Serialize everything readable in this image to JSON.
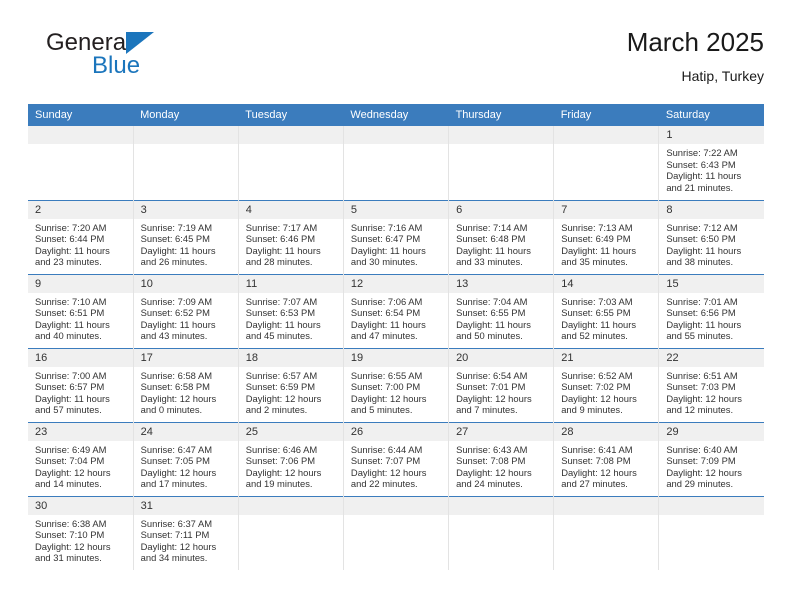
{
  "brand": {
    "name_part1": "General",
    "name_part2": "Blue",
    "accent_color": "#1b75bc"
  },
  "header": {
    "title": "March 2025",
    "location": "Hatip, Turkey"
  },
  "theme": {
    "header_row_background": "#3b7cbd",
    "day_number_background": "#f0f0f0",
    "grid_line": "#3b7cbd",
    "text": "#333333"
  },
  "weekday_headers": [
    "Sunday",
    "Monday",
    "Tuesday",
    "Wednesday",
    "Thursday",
    "Friday",
    "Saturday"
  ],
  "labels": {
    "sunrise_prefix": "Sunrise: ",
    "sunset_prefix": "Sunset: ",
    "daylight_prefix": "Daylight: "
  },
  "weeks": [
    [
      {
        "day": "",
        "empty": true
      },
      {
        "day": "",
        "empty": true
      },
      {
        "day": "",
        "empty": true
      },
      {
        "day": "",
        "empty": true
      },
      {
        "day": "",
        "empty": true
      },
      {
        "day": "",
        "empty": true
      },
      {
        "day": "1",
        "sunrise": "Sunrise: 7:22 AM",
        "sunset": "Sunset: 6:43 PM",
        "daylight_line1": "Daylight: 11 hours",
        "daylight_line2": "and 21 minutes."
      }
    ],
    [
      {
        "day": "2",
        "sunrise": "Sunrise: 7:20 AM",
        "sunset": "Sunset: 6:44 PM",
        "daylight_line1": "Daylight: 11 hours",
        "daylight_line2": "and 23 minutes."
      },
      {
        "day": "3",
        "sunrise": "Sunrise: 7:19 AM",
        "sunset": "Sunset: 6:45 PM",
        "daylight_line1": "Daylight: 11 hours",
        "daylight_line2": "and 26 minutes."
      },
      {
        "day": "4",
        "sunrise": "Sunrise: 7:17 AM",
        "sunset": "Sunset: 6:46 PM",
        "daylight_line1": "Daylight: 11 hours",
        "daylight_line2": "and 28 minutes."
      },
      {
        "day": "5",
        "sunrise": "Sunrise: 7:16 AM",
        "sunset": "Sunset: 6:47 PM",
        "daylight_line1": "Daylight: 11 hours",
        "daylight_line2": "and 30 minutes."
      },
      {
        "day": "6",
        "sunrise": "Sunrise: 7:14 AM",
        "sunset": "Sunset: 6:48 PM",
        "daylight_line1": "Daylight: 11 hours",
        "daylight_line2": "and 33 minutes."
      },
      {
        "day": "7",
        "sunrise": "Sunrise: 7:13 AM",
        "sunset": "Sunset: 6:49 PM",
        "daylight_line1": "Daylight: 11 hours",
        "daylight_line2": "and 35 minutes."
      },
      {
        "day": "8",
        "sunrise": "Sunrise: 7:12 AM",
        "sunset": "Sunset: 6:50 PM",
        "daylight_line1": "Daylight: 11 hours",
        "daylight_line2": "and 38 minutes."
      }
    ],
    [
      {
        "day": "9",
        "sunrise": "Sunrise: 7:10 AM",
        "sunset": "Sunset: 6:51 PM",
        "daylight_line1": "Daylight: 11 hours",
        "daylight_line2": "and 40 minutes."
      },
      {
        "day": "10",
        "sunrise": "Sunrise: 7:09 AM",
        "sunset": "Sunset: 6:52 PM",
        "daylight_line1": "Daylight: 11 hours",
        "daylight_line2": "and 43 minutes."
      },
      {
        "day": "11",
        "sunrise": "Sunrise: 7:07 AM",
        "sunset": "Sunset: 6:53 PM",
        "daylight_line1": "Daylight: 11 hours",
        "daylight_line2": "and 45 minutes."
      },
      {
        "day": "12",
        "sunrise": "Sunrise: 7:06 AM",
        "sunset": "Sunset: 6:54 PM",
        "daylight_line1": "Daylight: 11 hours",
        "daylight_line2": "and 47 minutes."
      },
      {
        "day": "13",
        "sunrise": "Sunrise: 7:04 AM",
        "sunset": "Sunset: 6:55 PM",
        "daylight_line1": "Daylight: 11 hours",
        "daylight_line2": "and 50 minutes."
      },
      {
        "day": "14",
        "sunrise": "Sunrise: 7:03 AM",
        "sunset": "Sunset: 6:55 PM",
        "daylight_line1": "Daylight: 11 hours",
        "daylight_line2": "and 52 minutes."
      },
      {
        "day": "15",
        "sunrise": "Sunrise: 7:01 AM",
        "sunset": "Sunset: 6:56 PM",
        "daylight_line1": "Daylight: 11 hours",
        "daylight_line2": "and 55 minutes."
      }
    ],
    [
      {
        "day": "16",
        "sunrise": "Sunrise: 7:00 AM",
        "sunset": "Sunset: 6:57 PM",
        "daylight_line1": "Daylight: 11 hours",
        "daylight_line2": "and 57 minutes."
      },
      {
        "day": "17",
        "sunrise": "Sunrise: 6:58 AM",
        "sunset": "Sunset: 6:58 PM",
        "daylight_line1": "Daylight: 12 hours",
        "daylight_line2": "and 0 minutes."
      },
      {
        "day": "18",
        "sunrise": "Sunrise: 6:57 AM",
        "sunset": "Sunset: 6:59 PM",
        "daylight_line1": "Daylight: 12 hours",
        "daylight_line2": "and 2 minutes."
      },
      {
        "day": "19",
        "sunrise": "Sunrise: 6:55 AM",
        "sunset": "Sunset: 7:00 PM",
        "daylight_line1": "Daylight: 12 hours",
        "daylight_line2": "and 5 minutes."
      },
      {
        "day": "20",
        "sunrise": "Sunrise: 6:54 AM",
        "sunset": "Sunset: 7:01 PM",
        "daylight_line1": "Daylight: 12 hours",
        "daylight_line2": "and 7 minutes."
      },
      {
        "day": "21",
        "sunrise": "Sunrise: 6:52 AM",
        "sunset": "Sunset: 7:02 PM",
        "daylight_line1": "Daylight: 12 hours",
        "daylight_line2": "and 9 minutes."
      },
      {
        "day": "22",
        "sunrise": "Sunrise: 6:51 AM",
        "sunset": "Sunset: 7:03 PM",
        "daylight_line1": "Daylight: 12 hours",
        "daylight_line2": "and 12 minutes."
      }
    ],
    [
      {
        "day": "23",
        "sunrise": "Sunrise: 6:49 AM",
        "sunset": "Sunset: 7:04 PM",
        "daylight_line1": "Daylight: 12 hours",
        "daylight_line2": "and 14 minutes."
      },
      {
        "day": "24",
        "sunrise": "Sunrise: 6:47 AM",
        "sunset": "Sunset: 7:05 PM",
        "daylight_line1": "Daylight: 12 hours",
        "daylight_line2": "and 17 minutes."
      },
      {
        "day": "25",
        "sunrise": "Sunrise: 6:46 AM",
        "sunset": "Sunset: 7:06 PM",
        "daylight_line1": "Daylight: 12 hours",
        "daylight_line2": "and 19 minutes."
      },
      {
        "day": "26",
        "sunrise": "Sunrise: 6:44 AM",
        "sunset": "Sunset: 7:07 PM",
        "daylight_line1": "Daylight: 12 hours",
        "daylight_line2": "and 22 minutes."
      },
      {
        "day": "27",
        "sunrise": "Sunrise: 6:43 AM",
        "sunset": "Sunset: 7:08 PM",
        "daylight_line1": "Daylight: 12 hours",
        "daylight_line2": "and 24 minutes."
      },
      {
        "day": "28",
        "sunrise": "Sunrise: 6:41 AM",
        "sunset": "Sunset: 7:08 PM",
        "daylight_line1": "Daylight: 12 hours",
        "daylight_line2": "and 27 minutes."
      },
      {
        "day": "29",
        "sunrise": "Sunrise: 6:40 AM",
        "sunset": "Sunset: 7:09 PM",
        "daylight_line1": "Daylight: 12 hours",
        "daylight_line2": "and 29 minutes."
      }
    ],
    [
      {
        "day": "30",
        "sunrise": "Sunrise: 6:38 AM",
        "sunset": "Sunset: 7:10 PM",
        "daylight_line1": "Daylight: 12 hours",
        "daylight_line2": "and 31 minutes."
      },
      {
        "day": "31",
        "sunrise": "Sunrise: 6:37 AM",
        "sunset": "Sunset: 7:11 PM",
        "daylight_line1": "Daylight: 12 hours",
        "daylight_line2": "and 34 minutes."
      },
      {
        "day": "",
        "empty": true
      },
      {
        "day": "",
        "empty": true
      },
      {
        "day": "",
        "empty": true
      },
      {
        "day": "",
        "empty": true
      },
      {
        "day": "",
        "empty": true
      }
    ]
  ]
}
